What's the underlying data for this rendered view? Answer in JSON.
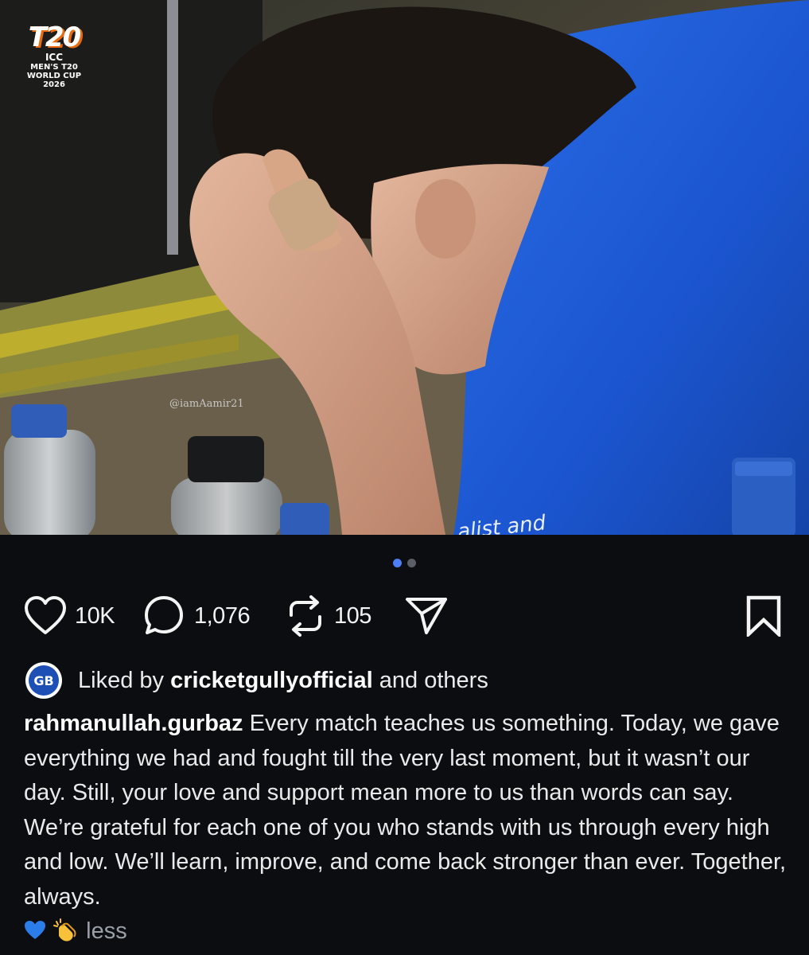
{
  "post": {
    "logo": {
      "mark": "T20",
      "org": "ICC",
      "line1": "MEN'S T20",
      "line2": "WORLD CUP",
      "year": "2026"
    },
    "watermark": "@iamAamir21",
    "jersey_text": "alist and",
    "carousel": {
      "count": 2,
      "active_index": 0
    }
  },
  "actions": {
    "likes": "10K",
    "comments": "1,076",
    "reposts": "105",
    "icons": [
      "heart-icon",
      "comment-icon",
      "repost-icon",
      "share-icon",
      "bookmark-icon"
    ]
  },
  "liked_by": {
    "avatar_text": "GB",
    "prefix": "Liked by",
    "username": "cricketgullyofficial",
    "suffix": "and others"
  },
  "caption": {
    "username": "rahmanullah.gurbaz",
    "text": "Every match teaches us something. Today, we gave everything we had and fought till the very last moment, but it wasn’t our day. Still, your love and support mean more to us than words can say. We’re grateful for each one of you who stands with us through every high and low. We’ll learn, improve, and come back stronger than ever. Together, always.",
    "emojis": [
      "blue-heart",
      "clapping-hands"
    ],
    "toggle": "less"
  },
  "colors": {
    "background": "#0b0d10",
    "accent_dot": "#4d7ef5",
    "jersey_blue": "#1f5ed6",
    "muted_text": "#9aa0a8"
  }
}
